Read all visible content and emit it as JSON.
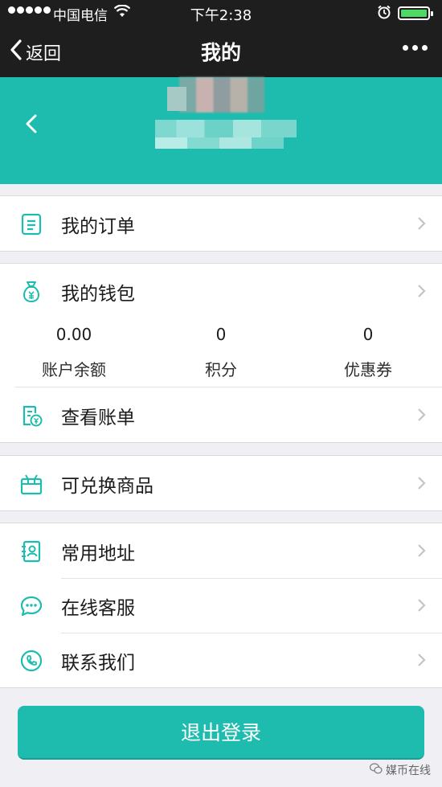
{
  "status_bar": {
    "carrier": "中国电信",
    "time": "下午2:38"
  },
  "nav": {
    "back_label": "返回",
    "title": "我的"
  },
  "menu": {
    "orders": "我的订单",
    "wallet": "我的钱包",
    "wallet_stats": [
      {
        "value": "0.00",
        "label": "账户余额"
      },
      {
        "value": "0",
        "label": "积分"
      },
      {
        "value": "0",
        "label": "优惠券"
      }
    ],
    "bill": "查看账单",
    "redeem": "可兑换商品",
    "address": "常用地址",
    "service": "在线客服",
    "contact": "联系我们"
  },
  "logout_label": "退出登录",
  "watermark": "媒币在线",
  "colors": {
    "accent": "#1ebcae",
    "bar_dark": "#1e1e1e",
    "background": "#efeff4"
  }
}
